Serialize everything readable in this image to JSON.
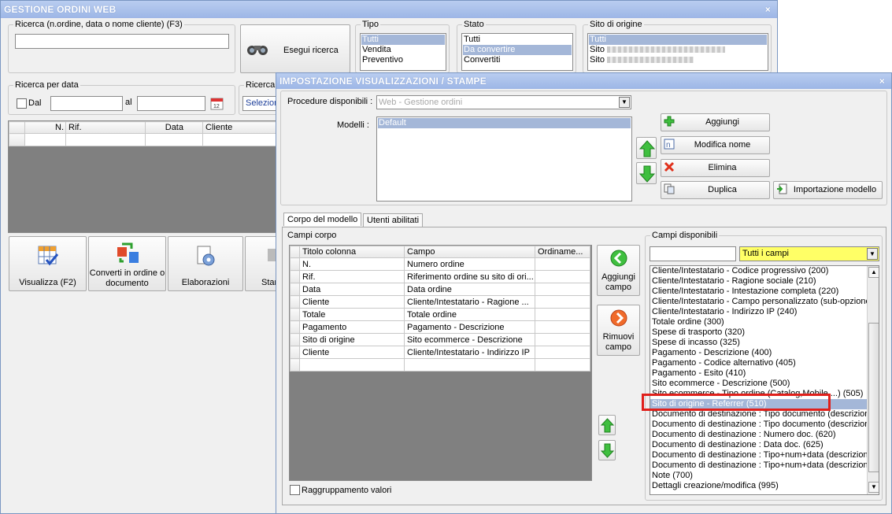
{
  "back": {
    "title": "GESTIONE ORDINI WEB",
    "close": "×",
    "search": {
      "legend": "Ricerca (n.ordine, data o nome cliente) (F3)",
      "value": "",
      "button": "Esegui ricerca"
    },
    "tipo": {
      "legend": "Tipo",
      "items": [
        "Tutti",
        "Vendita",
        "Preventivo"
      ],
      "selected": 0
    },
    "stato": {
      "legend": "Stato",
      "items": [
        "Tutti",
        "Da convertire",
        "Convertiti"
      ],
      "selected": 1
    },
    "sito": {
      "legend": "Sito di origine",
      "items": [
        "Tutti",
        "Sito",
        "Sito"
      ],
      "selected": 0
    },
    "date": {
      "legend": "Ricerca per data",
      "dal": "Dal",
      "al": "al"
    },
    "ricerca_p": {
      "legend": "Ricerca p",
      "value": "Selezion"
    },
    "grid_headers": [
      "N.",
      "Rif.",
      "Data",
      "Cliente"
    ],
    "actions": [
      {
        "label": "Visualizza (F2)",
        "icon": "grid-check-icon"
      },
      {
        "label": "Converti in ordine o documento",
        "icon": "convert-icon"
      },
      {
        "label": "Elaborazioni",
        "icon": "gear-document-icon"
      },
      {
        "label": "Stam",
        "icon": "printer-icon"
      }
    ]
  },
  "dialog": {
    "title": "IMPOSTAZIONE VISUALIZZAZIONI / STAMPE",
    "close": "×",
    "procedure_label": "Procedure disponibili :",
    "procedure_value": "Web - Gestione ordini",
    "modelli_label": "Modelli :",
    "modelli": [
      "Default"
    ],
    "buttons": {
      "aggiungi": "Aggiungi",
      "modifica": "Modifica nome",
      "elimina": "Elimina",
      "duplica": "Duplica",
      "importazione": "Importazione modello"
    },
    "tabs": [
      "Corpo del modello",
      "Utenti abilitati"
    ],
    "campi_corpo_label": "Campi corpo",
    "table_headers": [
      "Titolo colonna",
      "Campo",
      "Ordiname..."
    ],
    "rows": [
      [
        "N.",
        "Numero ordine",
        ""
      ],
      [
        "Rif.",
        "Riferimento ordine su sito di ori...",
        ""
      ],
      [
        "Data",
        "Data ordine",
        ""
      ],
      [
        "Cliente",
        "Cliente/Intestatario - Ragione ...",
        ""
      ],
      [
        "Totale",
        "Totale ordine",
        ""
      ],
      [
        "Pagamento",
        "Pagamento - Descrizione",
        ""
      ],
      [
        "Sito di origine",
        "Sito ecommerce - Descrizione",
        ""
      ],
      [
        "Cliente",
        "Cliente/Intestatario - Indirizzo IP",
        ""
      ],
      [
        "",
        "",
        ""
      ]
    ],
    "aggiungi_campo": [
      "Aggiungi",
      "campo"
    ],
    "rimuovi_campo": [
      "Rimuovi",
      "campo"
    ],
    "raggruppamento": "Raggruppamento valori",
    "campi_disponibili_label": "Campi disponibili",
    "filter_value": "Tutti i campi",
    "available": [
      "Cliente/Intestatario - Codice progressivo (200)",
      "Cliente/Intestatario - Ragione sociale (210)",
      "Cliente/Intestatario - Intestazione completa (220)",
      "Cliente/Intestatario - Campo personalizzato (sub-opzione",
      "Cliente/Intestatario - Indirizzo IP (240)",
      "Totale ordine (300)",
      "Spese di trasporto (320)",
      "Spese di incasso (325)",
      "Pagamento - Descrizione (400)",
      "Pagamento - Codice alternativo (405)",
      "Pagamento - Esito (410)",
      "Sito ecommerce - Descrizione (500)",
      "Sito ecommerce - Tipo ordine (Catalog,Mobile,...) (505)",
      "Sito di origine - Referrer (510)",
      "Documento di destinazione : Tipo documento (descrizione",
      "Documento di destinazione : Tipo documento (descrizione",
      "Documento di destinazione : Numero doc. (620)",
      "Documento di destinazione : Data doc. (625)",
      "Documento di destinazione : Tipo+num+data (descrizione",
      "Documento di destinazione : Tipo+num+data (descrizione",
      "Note (700)",
      "Dettagli creazione/modifica (995)"
    ],
    "available_selected": 13,
    "colors": {
      "highlight_box": "#e0201b",
      "selection": "#a4b7d8",
      "filter_bg": "#ffff66",
      "arrow_green": "#3fbf3f"
    }
  }
}
